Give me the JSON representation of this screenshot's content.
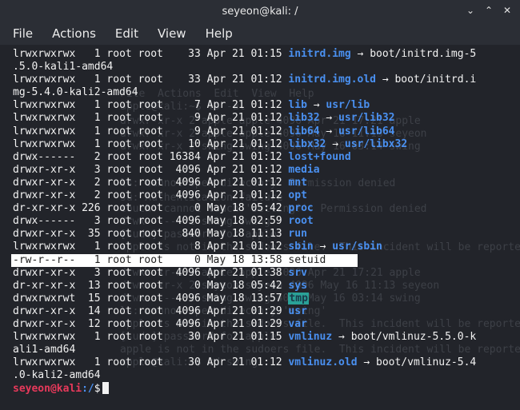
{
  "window": {
    "title": "seyeon@kali: /",
    "controls": [
      "minimize-icon",
      "maximize-icon",
      "close-icon"
    ],
    "control_glyphs": [
      "⌄",
      "⌃",
      "✕"
    ]
  },
  "menu": [
    "File",
    "Actions",
    "Edit",
    "View",
    "Help"
  ],
  "colors": {
    "dir": "#4a90f0",
    "prompt_user": "#e8395b",
    "tmp_bg": "#2aa198",
    "bg": "#22242a"
  },
  "ghost_lines": [
    "File  Actions  Edit  View  Help",
    "apple@kali:~$ ls -al",
    "drwxr-xr-x 2 apple apple 4096 Apr 21 17:21 apple",
    "drwxr-xr-x 2 apple apple 4096 May 18 11:13 seyeon",
    "drwxr-xr-x 2 swing swing 4096 May 16 03:14 swing",
    "ls: cannot open directory: Permission denied",
    "su: Authentication failure",
    "touch: cannot touch 'setting!': Permission denied",
    "drwx------ 2 swing swing",
    "[sudo] password for apple:",
    "apple is not in the sudoers file.  This incident will be reported.",
    "apple@kali:~$ cd swing",
    "drwxr-xr-x 2 apple apple 4096 Apr 21 17:21 apple",
    "drwxr-xr-x 2 seyeon seyeon 4096 May 16 11:13 seyeon",
    "drwx------ 2 swing swing 4096 May 16 03:14 swing",
    "ls: cannot open directory 'swing'",
    "apple is not in the sudoers file.  This incident will be reported.",
    "[sudo] password for apple:",
    "apple is not in the sudoers file.  This incident will be reported.",
    "apple@kali:~$ cd swing"
  ],
  "listing": [
    {
      "perm": "lrwxrwxrwx",
      "links": "  1",
      "owner": "root",
      "group": "root",
      "size": "   33",
      "date": "Apr 21 01:15",
      "name": "initrd.img",
      "target": "boot/initrd.img-5",
      "target_style": "plain"
    },
    {
      "cont": ".5.0-kali1-amd64"
    },
    {
      "perm": "lrwxrwxrwx",
      "links": "  1",
      "owner": "root",
      "group": "root",
      "size": "   33",
      "date": "Apr 21 01:12",
      "name": "initrd.img.old",
      "target": "boot/initrd.i",
      "target_style": "plain"
    },
    {
      "cont": "mg-5.4.0-kali2-amd64"
    },
    {
      "perm": "lrwxrwxrwx",
      "links": "  1",
      "owner": "root",
      "group": "root",
      "size": "    7",
      "date": "Apr 21 01:12",
      "name": "lib",
      "target": "usr/lib",
      "target_style": "dir"
    },
    {
      "perm": "lrwxrwxrwx",
      "links": "  1",
      "owner": "root",
      "group": "root",
      "size": "    9",
      "date": "Apr 21 01:12",
      "name": "lib32",
      "target": "usr/lib32",
      "target_style": "dir"
    },
    {
      "perm": "lrwxrwxrwx",
      "links": "  1",
      "owner": "root",
      "group": "root",
      "size": "    9",
      "date": "Apr 21 01:12",
      "name": "lib64",
      "target": "usr/lib64",
      "target_style": "dir"
    },
    {
      "perm": "lrwxrwxrwx",
      "links": "  1",
      "owner": "root",
      "group": "root",
      "size": "   10",
      "date": "Apr 21 01:12",
      "name": "libx32",
      "target": "usr/libx32",
      "target_style": "dir"
    },
    {
      "perm": "drwx------",
      "links": "  2",
      "owner": "root",
      "group": "root",
      "size": "16384",
      "date": "Apr 21 01:12",
      "name": "lost+found"
    },
    {
      "perm": "drwxr-xr-x",
      "links": "  3",
      "owner": "root",
      "group": "root",
      "size": " 4096",
      "date": "Apr 21 01:12",
      "name": "media"
    },
    {
      "perm": "drwxr-xr-x",
      "links": "  2",
      "owner": "root",
      "group": "root",
      "size": " 4096",
      "date": "Apr 21 01:12",
      "name": "mnt"
    },
    {
      "perm": "drwxr-xr-x",
      "links": "  2",
      "owner": "root",
      "group": "root",
      "size": " 4096",
      "date": "Apr 21 01:12",
      "name": "opt"
    },
    {
      "perm": "dr-xr-xr-x",
      "links": "226",
      "owner": "root",
      "group": "root",
      "size": "    0",
      "date": "May 18 05:42",
      "name": "proc"
    },
    {
      "perm": "drwx------",
      "links": "  3",
      "owner": "root",
      "group": "root",
      "size": " 4096",
      "date": "May 18 02:59",
      "name": "root"
    },
    {
      "perm": "drwxr-xr-x",
      "links": " 35",
      "owner": "root",
      "group": "root",
      "size": "  840",
      "date": "May 18 11:13",
      "name": "run"
    },
    {
      "perm": "lrwxrwxrwx",
      "links": "  1",
      "owner": "root",
      "group": "root",
      "size": "    8",
      "date": "Apr 21 01:12",
      "name": "sbin",
      "target": "usr/sbin",
      "target_style": "dir"
    },
    {
      "perm": "-rw-r--r--",
      "links": "  1",
      "owner": "root",
      "group": "root",
      "size": "    0",
      "date": "May 18 13:58",
      "name": "setuid",
      "selected": true
    },
    {
      "perm": "drwxr-xr-x",
      "links": "  3",
      "owner": "root",
      "group": "root",
      "size": " 4096",
      "date": "Apr 21 01:38",
      "name": "srv"
    },
    {
      "perm": "dr-xr-xr-x",
      "links": " 13",
      "owner": "root",
      "group": "root",
      "size": "    0",
      "date": "May 18 05:42",
      "name": "sys"
    },
    {
      "perm": "drwxrwxrwt",
      "links": " 15",
      "owner": "root",
      "group": "root",
      "size": " 4096",
      "date": "May 18 13:57",
      "name": "tmp",
      "highlight": true
    },
    {
      "perm": "drwxr-xr-x",
      "links": " 14",
      "owner": "root",
      "group": "root",
      "size": " 4096",
      "date": "Apr 21 01:29",
      "name": "usr"
    },
    {
      "perm": "drwxr-xr-x",
      "links": " 12",
      "owner": "root",
      "group": "root",
      "size": " 4096",
      "date": "Apr 21 01:29",
      "name": "var"
    },
    {
      "perm": "lrwxrwxrwx",
      "links": "  1",
      "owner": "root",
      "group": "root",
      "size": "   30",
      "date": "Apr 21 01:15",
      "name": "vmlinuz",
      "target": "boot/vmlinuz-5.5.0-k",
      "target_style": "plain"
    },
    {
      "cont": "ali1-amd64"
    },
    {
      "perm": "lrwxrwxrwx",
      "links": "  1",
      "owner": "root",
      "group": "root",
      "size": "   30",
      "date": "Apr 21 01:12",
      "name": "vmlinuz.old",
      "target": "boot/vmlinuz-5.4",
      "target_style": "plain"
    },
    {
      "cont": ".0-kali2-amd64"
    }
  ],
  "prompt": {
    "user_host": "seyeon@kali",
    "path": ":/",
    "symbol": "$"
  },
  "arrow": "→"
}
